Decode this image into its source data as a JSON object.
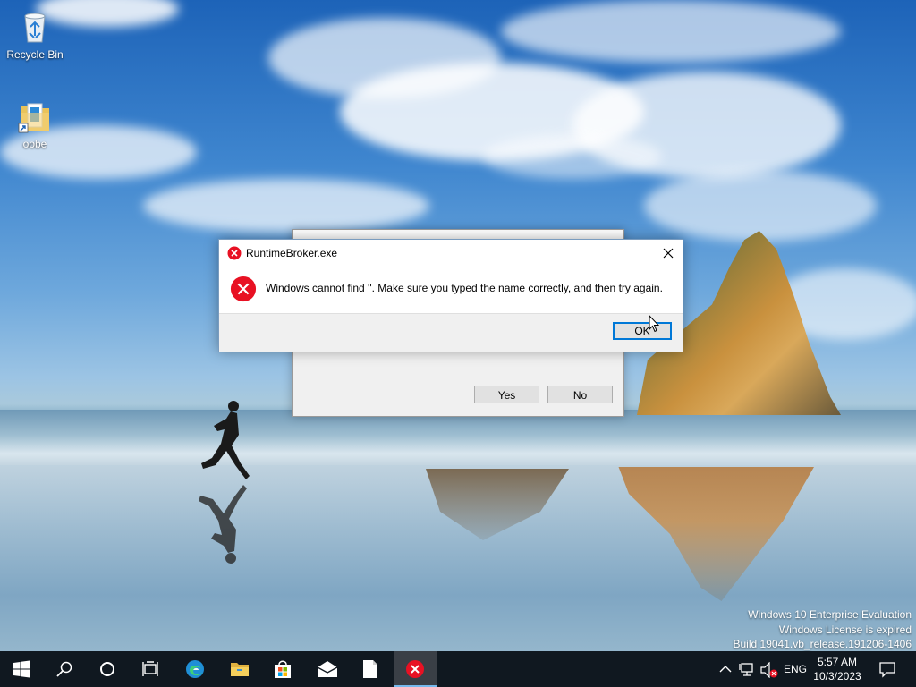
{
  "desktop": {
    "icons": [
      {
        "label": "Recycle Bin",
        "icon": "recycle-bin-icon"
      },
      {
        "label": "oobe",
        "icon": "folder-shortcut-icon"
      }
    ],
    "watermark": {
      "line1": "Windows 10 Enterprise Evaluation",
      "line2": "Windows License is expired",
      "line3": "Build 19041.vb_release.191206-1406"
    }
  },
  "background_dialog": {
    "yes_label": "Yes",
    "no_label": "No"
  },
  "error_dialog": {
    "title": "RuntimeBroker.exe",
    "message": "Windows cannot find ''. Make sure you typed the name correctly, and then try again.",
    "ok_label": "OK",
    "icon": "error-icon",
    "close_icon": "close-icon"
  },
  "taskbar": {
    "items": [
      {
        "name": "start",
        "icon": "windows-logo-icon"
      },
      {
        "name": "search",
        "icon": "search-icon"
      },
      {
        "name": "cortana",
        "icon": "cortana-circle-icon"
      },
      {
        "name": "task-view",
        "icon": "task-view-icon"
      },
      {
        "name": "edge",
        "icon": "edge-icon"
      },
      {
        "name": "file-explorer",
        "icon": "folder-icon"
      },
      {
        "name": "store",
        "icon": "store-icon"
      },
      {
        "name": "mail",
        "icon": "mail-icon"
      },
      {
        "name": "notepad",
        "icon": "document-icon"
      },
      {
        "name": "runtimebroker",
        "icon": "error-icon",
        "active": true
      }
    ],
    "tray": {
      "language": "ENG",
      "time": "5:57 AM",
      "date": "10/3/2023"
    },
    "colors": {
      "taskbar": "#101820",
      "accent": "#0078d7",
      "error": "#e81123"
    }
  }
}
